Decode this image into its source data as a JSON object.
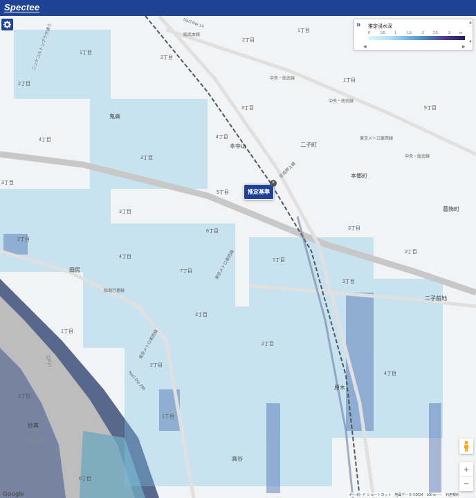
{
  "app": {
    "brand": "Spectee"
  },
  "legend": {
    "title": "推定浸水深",
    "ticks": [
      "0",
      "0.5",
      "1",
      "1.5",
      "2",
      "2.5",
      "3",
      "m"
    ],
    "expand_icon": "double-chevron-right-icon",
    "scroll_left_icon": "triangle-left-icon",
    "scroll_right_icon": "triangle-right-icon"
  },
  "marker": {
    "label": "推定基準",
    "close": "×"
  },
  "map_labels": {
    "route_14": "Nat'l Rte 14",
    "route_298": "Nat'l Rte 298",
    "sobu_line": "総武本線",
    "chuo_sobu": "中央・総武線",
    "tozai": "東京メトロ東西線",
    "keisei": "京成押上線",
    "nikkei": "ニッケコルトンプラザ通り",
    "chome_1": "1丁目",
    "chome_2": "2丁目",
    "chome_3": "3丁目",
    "chome_4": "4丁目",
    "chome_5": "5丁目",
    "chome_6": "6丁目",
    "chome_7": "7丁目",
    "onigoe": "鬼高",
    "motonakayama": "本中山",
    "futagocho": "二子町",
    "hongocho": "本郷町",
    "katsushika": "葛飾町",
    "tajiri": "田尻",
    "funabori": "船堀行徳線",
    "futamata": "二子前地",
    "myoten": "妙典",
    "myoten_park": "妙典公園",
    "takaya": "高谷",
    "haraki": "原木",
    "edogawa": "江戸川"
  },
  "controls": {
    "zoom_in": "+",
    "zoom_out": "−",
    "settings_icon": "gear-icon",
    "pegman_icon": "pegman-icon"
  },
  "footer": {
    "google": "Google",
    "attribution": "キーボード ショートカット　地図データ ©2024　100 m ──　利用規約"
  }
}
